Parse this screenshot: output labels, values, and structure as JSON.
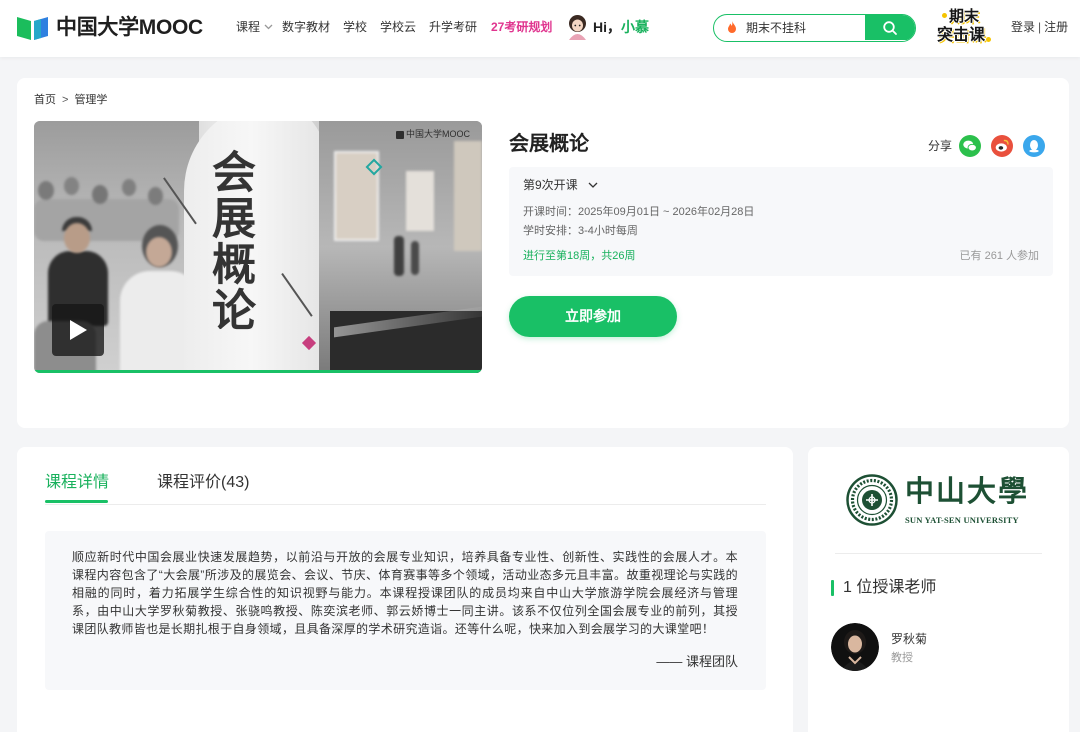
{
  "colors": {
    "primary": "#19c066",
    "primary_text": "#18b15c",
    "pink_accent": "#e0358f",
    "university_green": "#1d5034",
    "wechat": "#2cc04c",
    "weibo": "#e9503d",
    "qq": "#3aa7ec"
  },
  "header": {
    "logo_text": "中国大学MOOC",
    "logo_icon": "mooc-book-logo-icon",
    "nav": [
      {
        "label": "课程",
        "icon": "chevron-down-icon"
      },
      {
        "label": "数字教材"
      },
      {
        "label": "学校"
      },
      {
        "label": "学校云"
      },
      {
        "label": "升学考研"
      },
      {
        "label": "27考研规划"
      }
    ],
    "greeting": {
      "prefix": "Hi，",
      "name": "小慕",
      "avatar_icon": "xiaomu-avatar-icon"
    },
    "search": {
      "placeholder": "期末不挂科",
      "icon": "flame-icon",
      "button_icon": "search-icon"
    },
    "promo_badge": {
      "line1": "期末",
      "line2": "突击课"
    },
    "auth": {
      "login": "登录",
      "separator": "|",
      "register": "注册"
    }
  },
  "breadcrumb": {
    "home": "首页",
    "separator": ">",
    "category": "管理学"
  },
  "course": {
    "title": "会展概论",
    "thumbnail": {
      "title_art": "会展概论",
      "watermark": "中国大学MOOC",
      "play_icon": "play-icon"
    },
    "share": {
      "label": "分享",
      "channels": [
        {
          "icon": "wechat-icon"
        },
        {
          "icon": "weibo-icon"
        },
        {
          "icon": "qq-icon"
        }
      ]
    },
    "session": {
      "label": "第9次开课",
      "icon": "chevron-down-icon"
    },
    "dates": "开课时间：2025年09月01日 ~ 2026年02月28日",
    "hours": "学时安排：3-4小时每周",
    "progress": "进行至第18周，共26周",
    "enrolled": "已有 261 人参加",
    "join_button": "立即参加"
  },
  "details": {
    "tabs": [
      {
        "label": "课程详情",
        "active": true
      },
      {
        "label": "课程评价(43)",
        "active": false
      }
    ],
    "description": "顺应新时代中国会展业快速发展趋势，以前沿与开放的会展专业知识，培养具备专业性、创新性、实践性的会展人才。本课程内容包含了“大会展”所涉及的展览会、会议、节庆、体育赛事等多个领域，活动业态多元且丰富。故重视理论与实践的相融的同时，着力拓展学生综合性的知识视野与能力。本课程授课团队的成员均来自中山大学旅游学院会展经济与管理系，由中山大学罗秋菊教授、张骁鸣教授、陈奕滨老师、郭云娇博士一同主讲。该系不仅位列全国会展专业的前列，其授课团队教师皆也是长期扎根于自身领域，且具备深厚的学术研究造诣。还等什么呢，快来加入到会展学习的大课堂吧！",
    "signature": "—— 课程团队"
  },
  "school": {
    "name": "中山大學",
    "name_en": "SUN YAT-SEN UNIVERSITY",
    "seal_icon": "university-seal-icon"
  },
  "teachers": {
    "heading": "1 位授课老师",
    "list": [
      {
        "name": "罗秋菊",
        "title": "教授"
      }
    ]
  }
}
